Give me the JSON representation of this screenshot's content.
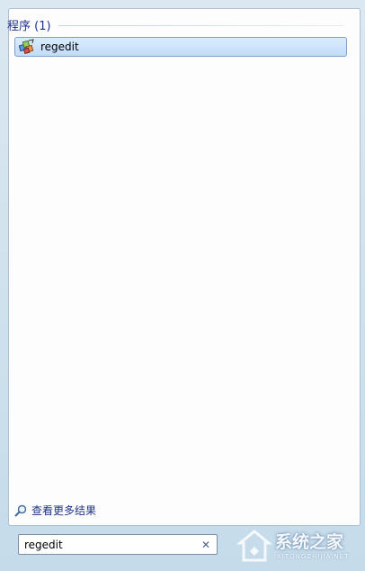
{
  "results": {
    "section_title": "程序 (1)",
    "items": [
      {
        "label": "regedit",
        "icon": "regedit-icon"
      }
    ]
  },
  "see_more": {
    "label": "查看更多结果",
    "icon": "search-icon"
  },
  "search": {
    "value": "regedit",
    "clear_icon": "close-icon"
  },
  "watermark": {
    "text": "系统之家",
    "subtext": "XITONGZHIJIA.NET"
  }
}
